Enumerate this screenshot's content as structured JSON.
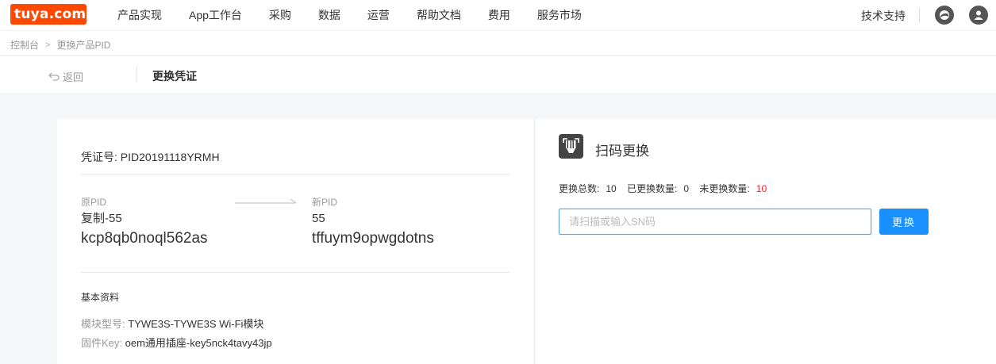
{
  "brand": {
    "logo_text": "tuya.com",
    "accent": "#ff4800"
  },
  "nav": {
    "items": [
      "产品实现",
      "App工作台",
      "采购",
      "数据",
      "运营",
      "帮助文档",
      "费用",
      "服务市场"
    ],
    "support": "技术支持",
    "icons": [
      "globe-icon",
      "user-icon"
    ]
  },
  "breadcrumb": {
    "home": "控制台",
    "current": "更换产品PID"
  },
  "subheader": {
    "back": "返回",
    "title": "更换凭证"
  },
  "voucher": {
    "label": "凭证号:",
    "value": "PID20191118YRMH"
  },
  "pid": {
    "old_label": "原PID",
    "old_name": "复制-55",
    "old_value": "kcp8qb0noql562as",
    "new_label": "新PID",
    "new_name": "55",
    "new_value": "tffuym9opwgdotns"
  },
  "basic": {
    "title": "基本资料",
    "model_label": "模块型号:",
    "model_value": "TYWE3S-TYWE3S Wi-Fi模块",
    "firmware_label": "固件Key:",
    "firmware_value": "oem通用插座-key5nck4tavy43jp"
  },
  "scan": {
    "title": "扫码更换",
    "total_label": "更换总数:",
    "total_value": "10",
    "done_label": "已更换数量:",
    "done_value": "0",
    "pending_label": "未更换数量:",
    "pending_value": "10",
    "pending_color": "#f5222d",
    "placeholder": "请扫描或输入SN码",
    "button": "更换",
    "button_color": "#1890ff"
  }
}
